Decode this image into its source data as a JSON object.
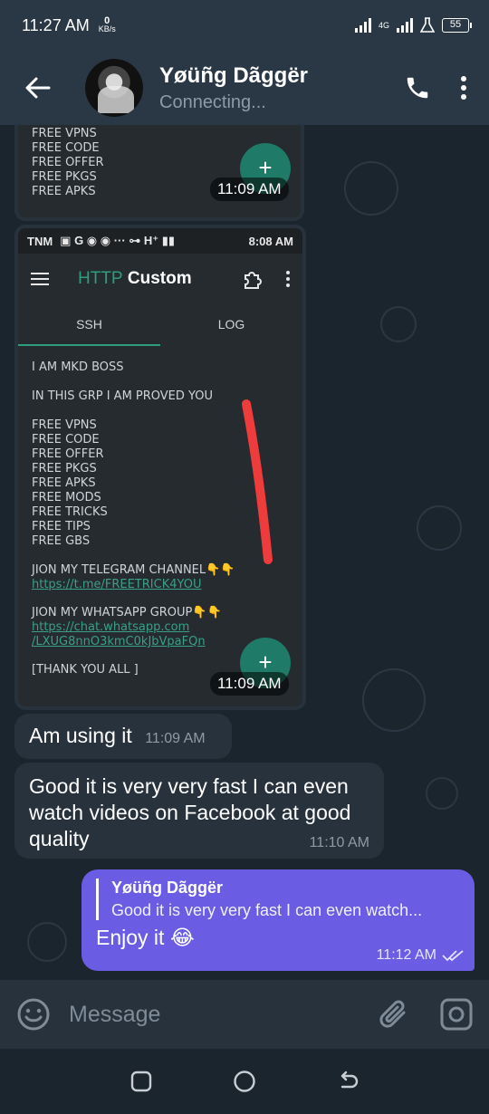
{
  "status_bar": {
    "time": "11:27 AM",
    "speed_value": "0",
    "speed_unit": "KB/s",
    "network": "4G",
    "battery": "55"
  },
  "header": {
    "contact_name": "Yøüñg Dãggër",
    "status": "Connecting..."
  },
  "messages": {
    "image1": {
      "lines": [
        "FREE VPNS",
        "FREE CODE",
        "FREE OFFER",
        "FREE PKGS",
        "FREE APKS"
      ],
      "fab": "+",
      "time": "11:09 AM"
    },
    "image2": {
      "status_left": "TNM",
      "status_right": "8:08 AM",
      "app_title_a": "HTTP",
      "app_title_b": "Custom",
      "tab_ssh": "SSH",
      "tab_log": "LOG",
      "line1": "I AM MKD BOSS",
      "line2": "IN THIS GRP I AM PROVED YOU",
      "free_list": [
        "FREE VPNS",
        "FREE CODE",
        "FREE OFFER",
        "FREE PKGS",
        "FREE APKS",
        "FREE MODS",
        "FREE TRICKS",
        "FREE TIPS",
        "FREE GBS"
      ],
      "telegram_label": "JION MY TELEGRAM CHANNEL👇👇",
      "telegram_link": "https://t.me/FREETRICK4YOU",
      "whatsapp_label": "JION MY WHATSAPP GROUP👇👇",
      "whatsapp_link_1": "https://chat.whatsapp.com",
      "whatsapp_link_2": "/LXUG8nnO3kmC0kJbVpaFQn",
      "thanks": "[THANK YOU ALL ]",
      "fab": "+",
      "time": "11:09 AM"
    },
    "msg3": {
      "text": "Am using it",
      "time": "11:09 AM"
    },
    "msg4": {
      "line1": "Good it is very very fast I can even",
      "line2": "watch videos on Facebook at good",
      "line3": "quality",
      "time": "11:10 AM"
    },
    "msg5": {
      "reply_name": "Yøüñg Dãggër",
      "reply_text": "Good it is very very fast I can even watch...",
      "text": "Enjoy it 😂",
      "time": "11:12 AM"
    }
  },
  "input": {
    "placeholder": "Message"
  },
  "colors": {
    "header_bg": "#2a3845",
    "chat_bg": "#1b252e",
    "incoming_bubble": "#27323c",
    "outgoing_bubble": "#6a5de3",
    "accent_teal": "#1f7a67"
  }
}
